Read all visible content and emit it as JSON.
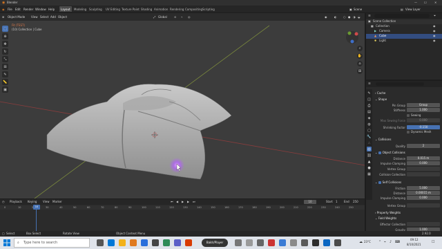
{
  "app": {
    "title": "Blender"
  },
  "window_controls": {
    "minimize": "—",
    "maximize": "☐",
    "close": "✕"
  },
  "menu": [
    "File",
    "Edit",
    "Render",
    "Window",
    "Help"
  ],
  "workspaces": [
    "Layout",
    "Modeling",
    "Sculpting",
    "UV Editing",
    "Texture Paint",
    "Shading",
    "Animation",
    "Rendering",
    "Compositing",
    "Scripting"
  ],
  "top_right": {
    "scene_label": "Scene",
    "view_layer_label": "View Layer"
  },
  "viewport": {
    "mode": "Object Mode",
    "header_menus": [
      "View",
      "Select",
      "Add",
      "Object"
    ],
    "transform": "Global",
    "info_line1": "Fit (TEST)",
    "info_line2": "(10) Collection | Cube"
  },
  "outliner": {
    "root": "Scene Collection",
    "items": [
      {
        "label": "Collection",
        "icon": "collection-icon"
      },
      {
        "label": "Camera",
        "icon": "camera-icon"
      },
      {
        "label": "Cube",
        "icon": "mesh-icon"
      },
      {
        "label": "Light",
        "icon": "light-icon"
      }
    ]
  },
  "properties": {
    "section_cache": "Cache",
    "section_shape": "Shape",
    "pin_group_label": "Pin Group",
    "pin_group_value": "Group",
    "stiffness_label": "Stiffness",
    "stiffness_value": "1.000",
    "sewing_label": "Sewing",
    "max_sewing_label": "Max Sewing Force",
    "max_sewing_value": "0.000",
    "shrinking_label": "Shrinking Factor",
    "shrinking_value": "-0.150",
    "dynamic_mesh_label": "Dynamic Mesh",
    "section_collisions": "Collisions",
    "quality_label": "Quality",
    "quality_value": "2",
    "object_collisions_label": "Object Collisions",
    "distance_label": "Distance",
    "distance_value": "0.015 m",
    "impulse_label": "Impulse Clamping",
    "impulse_value": "0.000",
    "vertex_group_label": "Vertex Group",
    "collision_collection_label": "Collision Collection",
    "self_collisions_label": "Self Collisions",
    "friction_label": "Friction",
    "friction_value": "5.000",
    "self_distance_value": "0.00015 m",
    "self_impulse_value": "0.000",
    "self_vertex_group_label": "Vertex Group",
    "section_property_weights": "Property Weights",
    "section_field_weights": "Field Weights",
    "effector_collection_label": "Effector Collection",
    "gravity_label": "Gravity",
    "gravity_value": "1.000"
  },
  "timeline": {
    "menus": [
      "Playback",
      "Keying",
      "View",
      "Marker"
    ],
    "current_frame": "10",
    "start_label": "Start",
    "start_value": "1",
    "end_label": "End",
    "end_value": "250",
    "ticks": [
      "0",
      "10",
      "20",
      "30",
      "40",
      "50",
      "60",
      "70",
      "80",
      "90",
      "100",
      "110",
      "120",
      "130",
      "140",
      "150",
      "160",
      "170",
      "180",
      "190",
      "200",
      "210",
      "220",
      "230",
      "240",
      "250"
    ]
  },
  "status": {
    "left": "Select",
    "mid1": "Box Select",
    "mid2": "Rotate View",
    "mid3": "Object Context Menu",
    "version": "2.92.0"
  },
  "taskbar": {
    "search_placeholder": "Type here to search",
    "pill_label": "Baldr/Player",
    "weather": "23°C",
    "time": "09:12",
    "date": "8/10/2021"
  },
  "colors": {
    "accent": "#4772b3",
    "viewport_bg": "#3c3c3c",
    "cursor_glow": "#b35cff"
  }
}
